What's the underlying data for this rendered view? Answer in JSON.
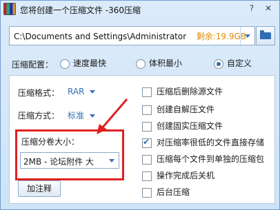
{
  "window": {
    "title": "您将创建一个压缩文件 -360压缩",
    "help_glyph": "?",
    "close_glyph": "✕"
  },
  "path_bar": {
    "path": "C:\\Documents and Settings\\Administrator\\桌",
    "free_space": "剩余:19.9GB"
  },
  "config": {
    "label": "压缩配置：",
    "options": [
      "速度最快",
      "体积最小",
      "自定义"
    ],
    "selected": "自定义"
  },
  "format": {
    "label": "压缩格式：",
    "value": "RAR"
  },
  "method": {
    "label": "压缩方式：",
    "value": "标准"
  },
  "split": {
    "label": "压缩分卷大小：",
    "value": "2MB     - 论坛附件 大"
  },
  "add_note_label": "加注释",
  "options": [
    {
      "label": "压缩后删除源文件",
      "checked": false
    },
    {
      "label": "创建自解压文件",
      "checked": false
    },
    {
      "label": "创建固实压缩文件",
      "checked": false
    },
    {
      "label": "对压缩率很低的文件直接存储",
      "checked": true
    },
    {
      "label": "压缩每个文件到单独的压缩包",
      "checked": false
    },
    {
      "label": "操作完成后关机",
      "checked": false
    },
    {
      "label": "后台压缩",
      "checked": false
    }
  ],
  "colors": {
    "accent": "#2f6db5",
    "free_space": "#e08a00",
    "highlight": "#e02020"
  },
  "icons": {
    "app": "archive-icon",
    "folder": "folder-icon"
  }
}
